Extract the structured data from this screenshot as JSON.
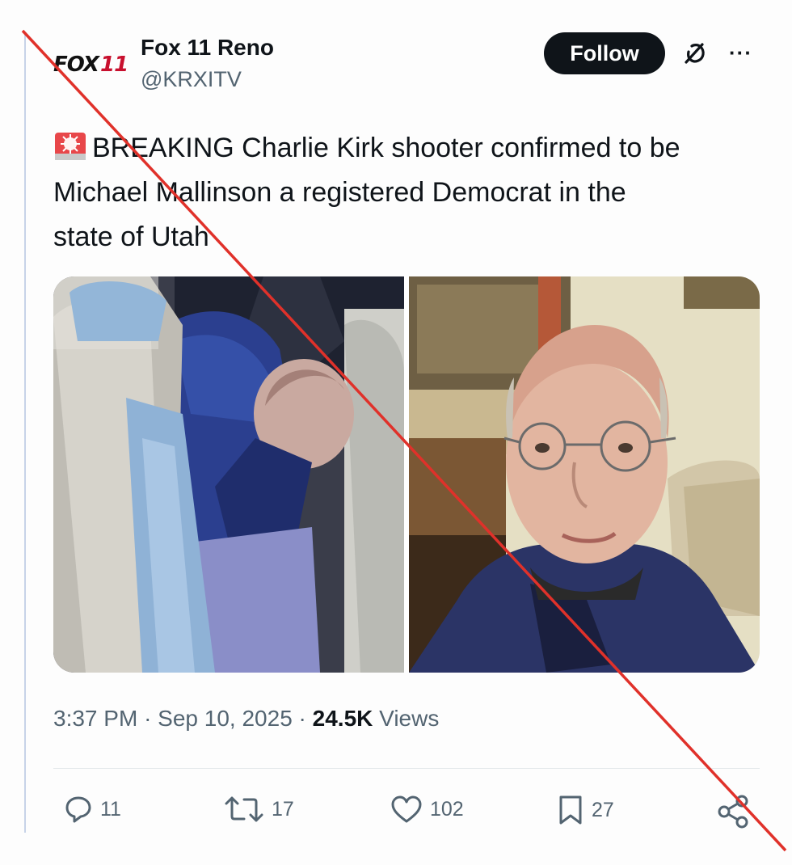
{
  "account": {
    "logo_text": "FOX",
    "logo_number": "11",
    "name": "Fox 11 Reno",
    "handle": "@KRXITV"
  },
  "follow_label": "Follow",
  "more_label": "···",
  "tweet": {
    "emoji_icon": "rotating-light-icon",
    "text_line1": "BREAKING Charlie Kirk shooter confirmed to be",
    "text_line2": "Michael Mallinson a registered Democrat in the",
    "text_line3": "state of Utah"
  },
  "meta": {
    "time": "3:37 PM",
    "sep1": "·",
    "date": "Sep 10, 2025",
    "sep2": "·",
    "views_count": "24.5K",
    "views_label": "Views"
  },
  "actions": {
    "replies": "11",
    "reposts": "17",
    "likes": "102",
    "bookmarks": "27"
  },
  "colors": {
    "strike": "#e0312a",
    "follow_bg": "#0f1419",
    "secondary_text": "#536471"
  }
}
